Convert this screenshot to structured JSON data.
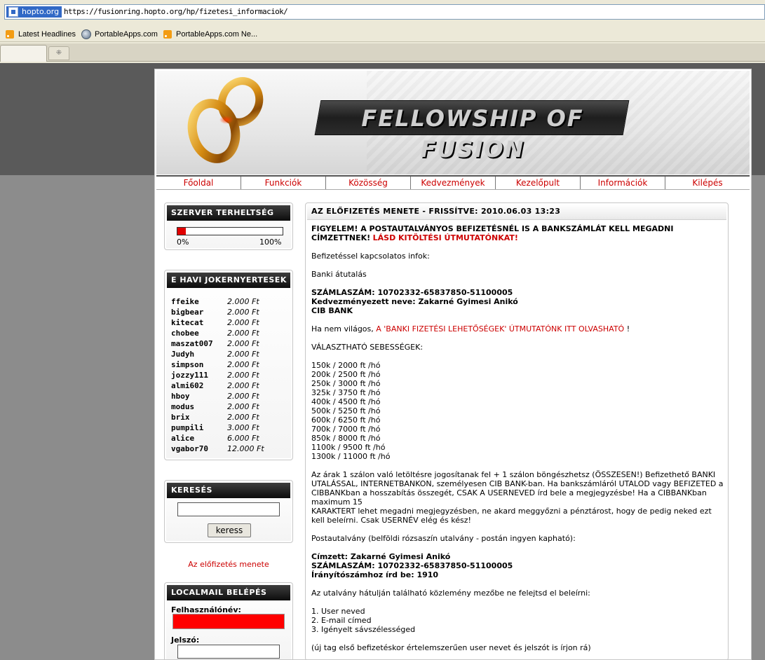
{
  "browser": {
    "site_badge": "hopto.org",
    "url": "https://fusionring.hopto.org/hp/fizetesi_informaciok/",
    "bookmarks": [
      {
        "label": "Latest Headlines",
        "icon": "rss-icon"
      },
      {
        "label": "PortableApps.com",
        "icon": "globe-icon"
      },
      {
        "label": "PortableApps.com Ne...",
        "icon": "rss-icon"
      }
    ]
  },
  "banner": {
    "title": "FELLOWSHIP OF FUSION",
    "logo_icon": "gold-rings-icon"
  },
  "nav": {
    "items": [
      "Főoldal",
      "Funkciók",
      "Közösség",
      "Kedvezmények",
      "Kezelőpult",
      "Információk",
      "Kilépés"
    ]
  },
  "server_load": {
    "title": "SZERVER TERHELTSÉG",
    "value_fraction": 0.08,
    "min_label": "0%",
    "max_label": "100%"
  },
  "jokers": {
    "title": "E HAVI JOKERNYERTESEK",
    "rows": [
      {
        "name": "ffeike",
        "amount": "2.000 Ft"
      },
      {
        "name": "bigbear",
        "amount": "2.000 Ft"
      },
      {
        "name": "kitecat",
        "amount": "2.000 Ft"
      },
      {
        "name": "chobee",
        "amount": "2.000 Ft"
      },
      {
        "name": "maszat007",
        "amount": "2.000 Ft"
      },
      {
        "name": "Judyh",
        "amount": "2.000 Ft"
      },
      {
        "name": "simpson",
        "amount": "2.000 Ft"
      },
      {
        "name": "jozzy111",
        "amount": "2.000 Ft"
      },
      {
        "name": "almi602",
        "amount": "2.000 Ft"
      },
      {
        "name": "hboy",
        "amount": "2.000 Ft"
      },
      {
        "name": "modus",
        "amount": "2.000 Ft"
      },
      {
        "name": "brix",
        "amount": "2.000 Ft"
      },
      {
        "name": "pumpili",
        "amount": "3.000 Ft"
      },
      {
        "name": "alice",
        "amount": "6.000 Ft"
      },
      {
        "name": "vgabor70",
        "amount": "12.000 Ft"
      }
    ]
  },
  "search": {
    "title": "KERESÉS",
    "value": "",
    "button_label": "keress"
  },
  "howto_link": "Az előfizetés menete",
  "localmail": {
    "title": "LOCALMAIL BELÉPÉS",
    "username_label": "Felhasználónév:",
    "password_label": "Jelszó:"
  },
  "main": {
    "title": "AZ ELŐFIZETÉS MENETE - FRISSÍTVE: 2010.06.03 13:23",
    "warning_bold": "FIGYELEM! A POSTAUTALVÁNYOS BEFIZETÉSNÉL IS A BANKSZÁMLÁT KELL MEGADNI CÍMZETTNEK!",
    "warning_link": "LÁSD KITÖLTÉSI ÚTMUTATÓNKAT!",
    "intro": "Befizetéssel kapcsolatos infok:",
    "bank_transfer": "Banki átutalás",
    "account_line": "SZÁMLASZÁM: 10702332-65837850-51100005",
    "beneficiary_line": "Kedvezményezett neve: Zakarné Gyimesi Anikó",
    "bank_name": "CIB BANK",
    "help_prefix": "Ha nem világos,",
    "help_link": "A 'BANKI FIZETÉSI LEHETŐSÉGEK' ÚTMUTATÓNK ITT OLVASHATÓ",
    "help_suffix": "!",
    "speeds_title": "VÁLASZTHATÓ SEBESSÉGEK:",
    "speeds": [
      "150k / 2000 ft /hó",
      "200k / 2500 ft /hó",
      "250k / 3000 ft /hó",
      "325k / 3750 ft /hó",
      "400k / 4500 ft /hó",
      "500k / 5250 ft /hó",
      "600k / 6250 ft /hó",
      "700k / 7000 ft /hó",
      "850k / 8000 ft /hó",
      "1100k / 9500 ft /hó",
      "1300k / 11000 ft /hó"
    ],
    "prices_paragraph_1": "Az árak 1 szálon való letöltésre jogosítanak fel + 1 szálon böngészhetsz (ÖSSZESEN!) Befizethető BANKI UTALÁSSAL, INTERNETBANKON, személyesen CIB BANK-ban. Ha bankszámláról UTALOD vagy BEFIZETED a CIBBANKban a hosszabítás összegét, CSAK A USERNEVED írd bele a megjegyzésbe! Ha a CIBBANKban maximum 15",
    "prices_paragraph_2": "KARAKTERT lehet megadni megjegyzésben, ne akard meggyőzni a pénztárost, hogy de pedig neked ezt kell beleírni. Csak USERNÉV elég és kész!",
    "postal_title": "Postautalvány (belföldi rózsaszín utalvány - postán ingyen kapható):",
    "postal_recipient": "Címzett: Zakarné Gyimesi Anikó",
    "postal_account": "SZÁMLASZÁM: 10702332-65837850-51100005",
    "postal_zip": "Írányítószámhoz írd be: 1910",
    "notice_title": "Az utalvány hátulján található közlemény mezőbe ne felejtsd el beleírni:",
    "notice_items": [
      "1. User neved",
      "2. E-mail címed",
      "3. Igényelt sávszélességed"
    ],
    "footer_note": "(új tag első befizetéskor értelemszerűen user nevet és jelszót is írjon rá)"
  }
}
